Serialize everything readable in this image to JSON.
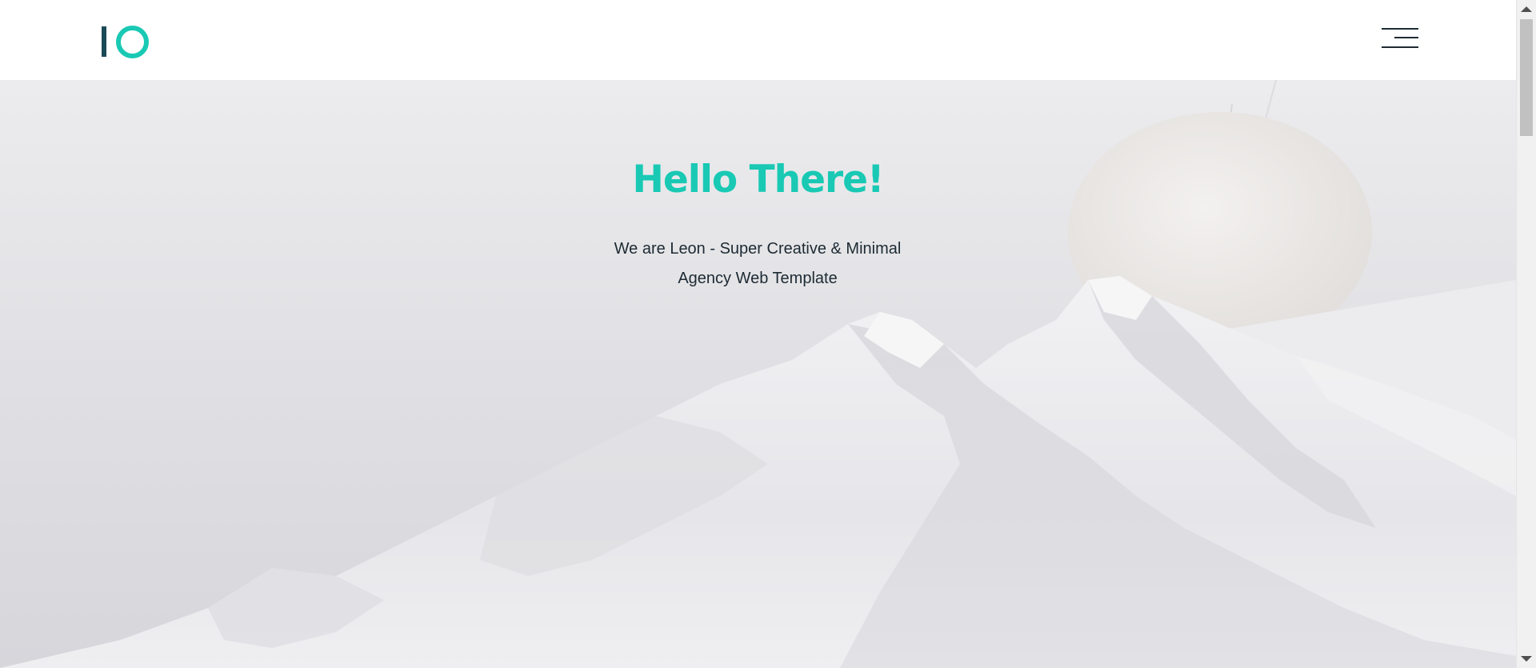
{
  "theme": {
    "accent": "#19c9b4",
    "logo_dark": "#1c4a56"
  },
  "header": {
    "logo_icon": "io-logo-icon",
    "menu_icon": "hamburger-menu-icon"
  },
  "hero": {
    "title": "Hello There!",
    "subtitle_line1": "We are Leon - Super Creative & Minimal",
    "subtitle_line2": "Agency Web Template",
    "background": "snowy-mountain-photo"
  },
  "scrollbar": {
    "thumb_fraction": 0.18
  }
}
